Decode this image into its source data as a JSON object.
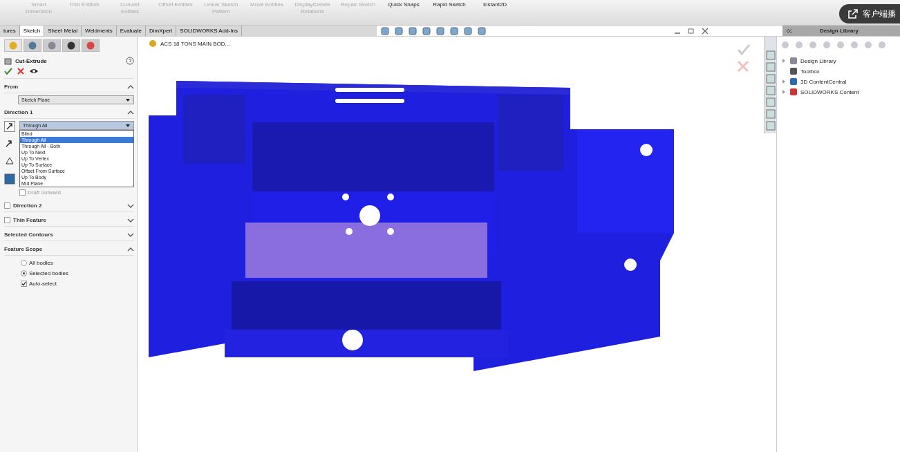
{
  "ribbon": {
    "groups": [
      {
        "label": "Smart Dimension",
        "dim": true
      },
      {
        "label": "Trim Entities",
        "dim": true
      },
      {
        "label": "Convert Entities",
        "dim": true
      },
      {
        "label": "Offset Entities",
        "dim": true
      },
      {
        "label": "Linear Sketch Pattern",
        "dim": true
      },
      {
        "label": "Move Entities",
        "dim": true
      },
      {
        "label": "Display/Delete Relations",
        "dim": true
      },
      {
        "label": "Repair Sketch",
        "dim": true
      },
      {
        "label": "Quick Snaps",
        "dim": false
      },
      {
        "label": "Rapid Sketch",
        "dim": false
      },
      {
        "label": "Instant2D",
        "dim": false
      }
    ]
  },
  "overlay_button": {
    "label": "客户端播"
  },
  "tabs": [
    {
      "label": "tures",
      "selected": false
    },
    {
      "label": "Sketch",
      "selected": true
    },
    {
      "label": "Sheet Metal",
      "selected": false
    },
    {
      "label": "Weldments",
      "selected": false
    },
    {
      "label": "Evaluate",
      "selected": false
    },
    {
      "label": "DimXpert",
      "selected": false
    },
    {
      "label": "SOLIDWORKS Add-Ins",
      "selected": false
    }
  ],
  "property_manager": {
    "panel_tabs": [
      {
        "selected": true
      },
      {
        "selected": false
      },
      {
        "selected": false
      },
      {
        "selected": false
      },
      {
        "selected": false
      }
    ],
    "title": "Cut-Extrude",
    "from": {
      "label": "From",
      "value": "Sketch Plane"
    },
    "direction1": {
      "label": "Direction 1",
      "value": "Through All",
      "options": [
        {
          "label": "Blind",
          "selected": false
        },
        {
          "label": "Through All",
          "selected": true
        },
        {
          "label": "Through All - Both",
          "selected": false
        },
        {
          "label": "Up To Next",
          "selected": false
        },
        {
          "label": "Up To Vertex",
          "selected": false
        },
        {
          "label": "Up To Surface",
          "selected": false
        },
        {
          "label": "Offset From Surface",
          "selected": false
        },
        {
          "label": "Up To Body",
          "selected": false
        },
        {
          "label": "Mid Plane",
          "selected": false
        }
      ],
      "draft": {
        "label": "Draft outward",
        "checked": false
      }
    },
    "sections": [
      {
        "label": "Direction 2",
        "checkbox": true,
        "checked": false,
        "expanded": false
      },
      {
        "label": "Thin Feature",
        "checkbox": true,
        "checked": false,
        "expanded": false
      },
      {
        "label": "Selected Contours",
        "checkbox": false,
        "expanded": false
      }
    ],
    "scope": {
      "label": "Feature Scope",
      "expanded": true,
      "options": [
        {
          "label": "All bodies",
          "selected": false
        },
        {
          "label": "Selected bodies",
          "selected": true
        }
      ],
      "auto_select": {
        "label": "Auto-select",
        "checked": true
      }
    }
  },
  "viewport": {
    "tree_item": "ACS 18 TONS MAIN BOD..."
  },
  "design_library": {
    "title": "Design Library",
    "items": [
      {
        "label": "Design Library",
        "expandable": true
      },
      {
        "label": "Toolbox",
        "expandable": false
      },
      {
        "label": "3D ContentCentral",
        "expandable": true
      },
      {
        "label": "SOLIDWORKS Content",
        "expandable": true
      }
    ]
  }
}
